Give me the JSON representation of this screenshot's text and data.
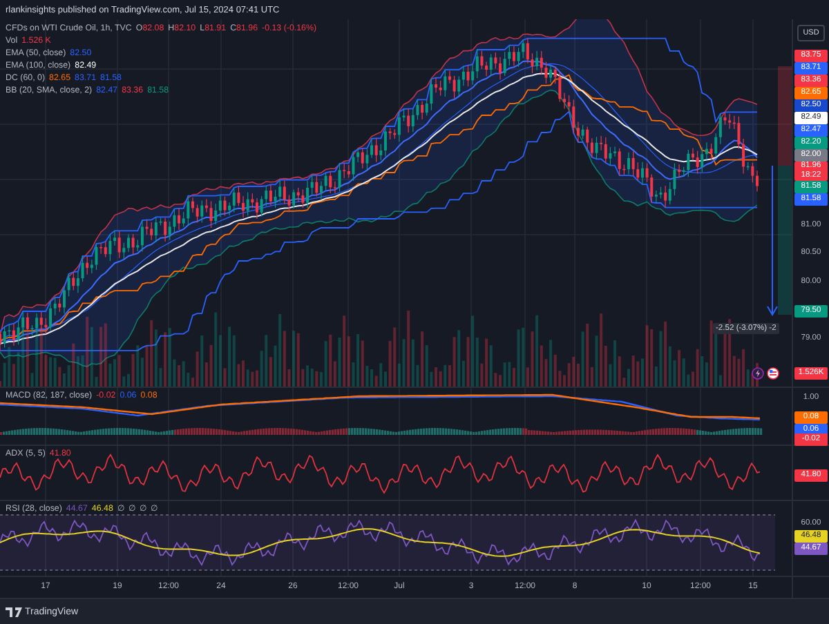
{
  "header": {
    "caption": "rlankinsights published on TradingView.com, Jul 15, 2024 07:41 UTC"
  },
  "main_pane": {
    "legend": {
      "title": "CFDs on WTI Crude Oil, 1h, TVC",
      "ohlc": [
        {
          "label": "O",
          "value": "82.08"
        },
        {
          "label": "H",
          "value": "82.10"
        },
        {
          "label": "L",
          "value": "81.91"
        },
        {
          "label": "C",
          "value": "81.96"
        }
      ],
      "change": "-0.13 (-0.16%)",
      "indicators": [
        {
          "name": "Vol",
          "values": [
            {
              "text": "1.526 K",
              "color": "#f23645"
            }
          ]
        },
        {
          "name": "EMA (50, close)",
          "values": [
            {
              "text": "82.50",
              "color": "#2962ff"
            }
          ]
        },
        {
          "name": "EMA (100, close)",
          "values": [
            {
              "text": "82.49",
              "color": "#ffffff"
            }
          ]
        },
        {
          "name": "DC (60, 0)",
          "values": [
            {
              "text": "82.65",
              "color": "#ff6d00"
            },
            {
              "text": "83.71",
              "color": "#2962ff"
            },
            {
              "text": "81.58",
              "color": "#2962ff"
            }
          ]
        },
        {
          "name": "BB (20, SMA, close, 2)",
          "values": [
            {
              "text": "82.47",
              "color": "#2962ff"
            },
            {
              "text": "83.36",
              "color": "#f23645"
            },
            {
              "text": "81.58",
              "color": "#089981"
            }
          ]
        }
      ]
    },
    "currency": "USD",
    "measure": "-2.52 (-3.07%) -2",
    "axis_labels": [
      {
        "text": "83.75",
        "color": "#f23645"
      },
      {
        "text": "83.71",
        "color": "#2962ff"
      },
      {
        "text": "83.36",
        "color": "#f23645"
      },
      {
        "text": "82.65",
        "color": "#ff6d00"
      },
      {
        "text": "82.50",
        "color": "#1848cc"
      },
      {
        "text": "82.49",
        "color": "#ffffff"
      },
      {
        "text": "82.47",
        "color": "#2962ff"
      },
      {
        "text": "82.20",
        "color": "#089981"
      },
      {
        "text": "82.00",
        "color": "#787b86"
      },
      {
        "text": "81.96",
        "countdown": "18:22",
        "color": "#f23645"
      },
      {
        "text": "81.58",
        "color": "#089981"
      },
      {
        "text": "81.58",
        "color": "#2962ff"
      },
      {
        "text": "81.00"
      },
      {
        "text": "80.50"
      },
      {
        "text": "80.00"
      },
      {
        "text": "79.50",
        "color": "#089981"
      },
      {
        "text": "79.00"
      },
      {
        "text": "1.526K",
        "color": "#f23645"
      }
    ]
  },
  "panes": [
    {
      "kind": "macd",
      "legend": {
        "name": "MACD (82, 187, close)",
        "values": [
          {
            "text": "-0.02",
            "color": "#f23645"
          },
          {
            "text": "0.06",
            "color": "#2962ff"
          },
          {
            "text": "0.08",
            "color": "#ff6d00"
          }
        ]
      },
      "axis_labels": [
        {
          "text": "1.00"
        },
        {
          "text": "0.08",
          "color": "#ff6d00"
        },
        {
          "text": "0.06",
          "color": "#2962ff"
        },
        {
          "text": "-0.02",
          "color": "#f23645"
        }
      ]
    },
    {
      "kind": "adx",
      "legend": {
        "name": "ADX (5, 5)",
        "values": [
          {
            "text": "41.80",
            "color": "#f23645"
          }
        ]
      },
      "axis_labels": [
        {
          "text": "41.80",
          "color": "#f23645"
        }
      ]
    },
    {
      "kind": "rsi",
      "legend": {
        "name": "RSI (28, close)",
        "values": [
          {
            "text": "44.67",
            "color": "#7e57c2"
          },
          {
            "text": "46.48",
            "color": "#e6d224"
          },
          {
            "text": "∅"
          },
          {
            "text": "∅"
          },
          {
            "text": "∅"
          },
          {
            "text": "∅"
          }
        ]
      },
      "axis_labels": [
        {
          "text": "60.00"
        },
        {
          "text": "46.48",
          "color": "#e6d224"
        },
        {
          "text": "44.67",
          "color": "#7e57c2"
        }
      ]
    }
  ],
  "time_axis": {
    "ticks": [
      "17",
      "19",
      "12:00",
      "24",
      "26",
      "12:00",
      "Jul",
      "3",
      "12:00",
      "8",
      "10",
      "12:00",
      "15"
    ]
  },
  "footer": {
    "brand": "TradingView"
  }
}
